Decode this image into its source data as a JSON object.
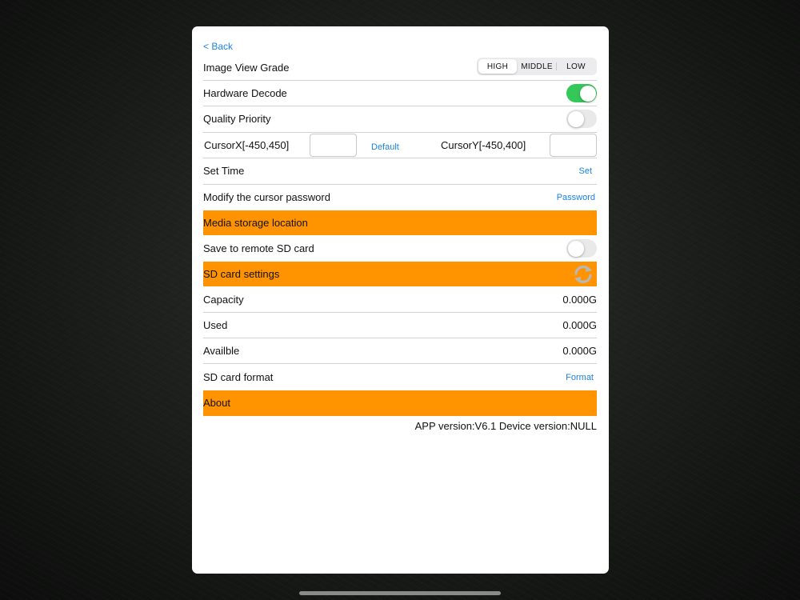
{
  "nav": {
    "back_label": "< Back"
  },
  "image_view_grade": {
    "label": "Image View Grade",
    "options": [
      "HIGH",
      "MIDDLE",
      "LOW"
    ],
    "selected": "HIGH"
  },
  "hardware_decode": {
    "label": "Hardware Decode",
    "on": true
  },
  "quality_priority": {
    "label": "Quality Priority",
    "on": false
  },
  "cursor": {
    "x_label": "CursorX[-450,450]",
    "x_value": "",
    "default_label": "Default",
    "y_label": "CursorY[-450,400]",
    "y_value": ""
  },
  "set_time": {
    "label": "Set Time",
    "action": "Set"
  },
  "cursor_password": {
    "label": "Modify the cursor password",
    "action": "Password"
  },
  "sections": {
    "media_storage": "Media storage location",
    "sd_card_settings": "SD card settings",
    "about": "About"
  },
  "save_remote_sd": {
    "label": "Save to remote SD card",
    "on": false
  },
  "sd_card": {
    "capacity_label": "Capacity",
    "capacity_value": "0.000G",
    "used_label": "Used",
    "used_value": "0.000G",
    "available_label": "Availble",
    "available_value": "0.000G",
    "format_label": "SD card format",
    "format_action": "Format"
  },
  "footer": {
    "version_text": "APP version:V6.1 Device version:NULL"
  },
  "colors": {
    "accent_blue": "#1a82e6",
    "section_orange": "#ff9300",
    "toggle_green": "#34c759"
  },
  "icons": {
    "refresh": "refresh-icon"
  }
}
